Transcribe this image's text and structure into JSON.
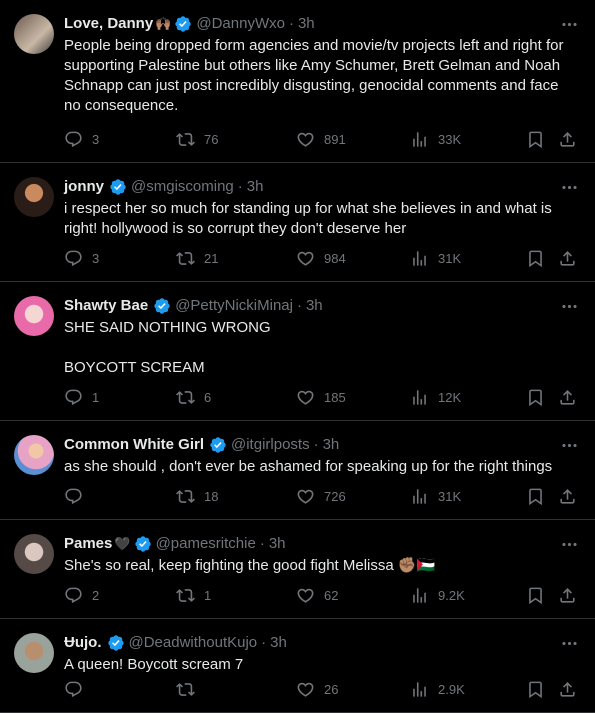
{
  "colors": {
    "background": "#000000",
    "text": "#e7e9ea",
    "muted": "#71767b",
    "verified": "#1d9bf0",
    "divider": "#2f3336"
  },
  "icons": [
    "reply-icon",
    "retweet-icon",
    "like-icon",
    "views-icon",
    "bookmark-icon",
    "share-icon",
    "more-icon",
    "verified-badge-icon"
  ],
  "tweets": [
    {
      "name": "Love, Danny",
      "emoji": "🙌🏽",
      "handle": "@DannyWxo",
      "time": "3h",
      "text": "People being dropped form agencies and movie/tv projects left and right for supporting Palestine but others like Amy Schumer, Brett Gelman and Noah Schnapp can just post incredibly disgusting, genocidal comments and face no consequence.",
      "replies": "3",
      "retweets": "76",
      "likes": "891",
      "views": "33K"
    },
    {
      "name": "jonny",
      "emoji": "",
      "handle": "@smgiscoming",
      "time": "3h",
      "text": "i respect her so much for standing up for what she believes in and what is right! hollywood is so corrupt they don't deserve her",
      "replies": "3",
      "retweets": "21",
      "likes": "984",
      "views": "31K"
    },
    {
      "name": "Shawty Bae",
      "emoji": "",
      "handle": "@PettyNickiMinaj",
      "time": "3h",
      "text": "SHE SAID NOTHING WRONG\n\nBOYCOTT SCREAM",
      "replies": "1",
      "retweets": "6",
      "likes": "185",
      "views": "12K"
    },
    {
      "name": "Common White Girl",
      "emoji": "",
      "handle": "@itgirlposts",
      "time": "3h",
      "text": "as she should , don't ever be ashamed for speaking up for the right things",
      "replies": "",
      "retweets": "18",
      "likes": "726",
      "views": "31K"
    },
    {
      "name": "Pames",
      "emoji": "🖤",
      "handle": "@pamesritchie",
      "time": "3h",
      "text": "She's so real, keep fighting the good fight Melissa ✊🏽🇵🇸",
      "replies": "2",
      "retweets": "1",
      "likes": "62",
      "views": "9.2K"
    },
    {
      "name": "Ʉujo.",
      "emoji": "",
      "handle": "@DeadwithoutKujo",
      "time": "3h",
      "text": "A queen! Boycott scream 7",
      "replies": "",
      "retweets": "",
      "likes": "26",
      "views": "2.9K"
    }
  ]
}
